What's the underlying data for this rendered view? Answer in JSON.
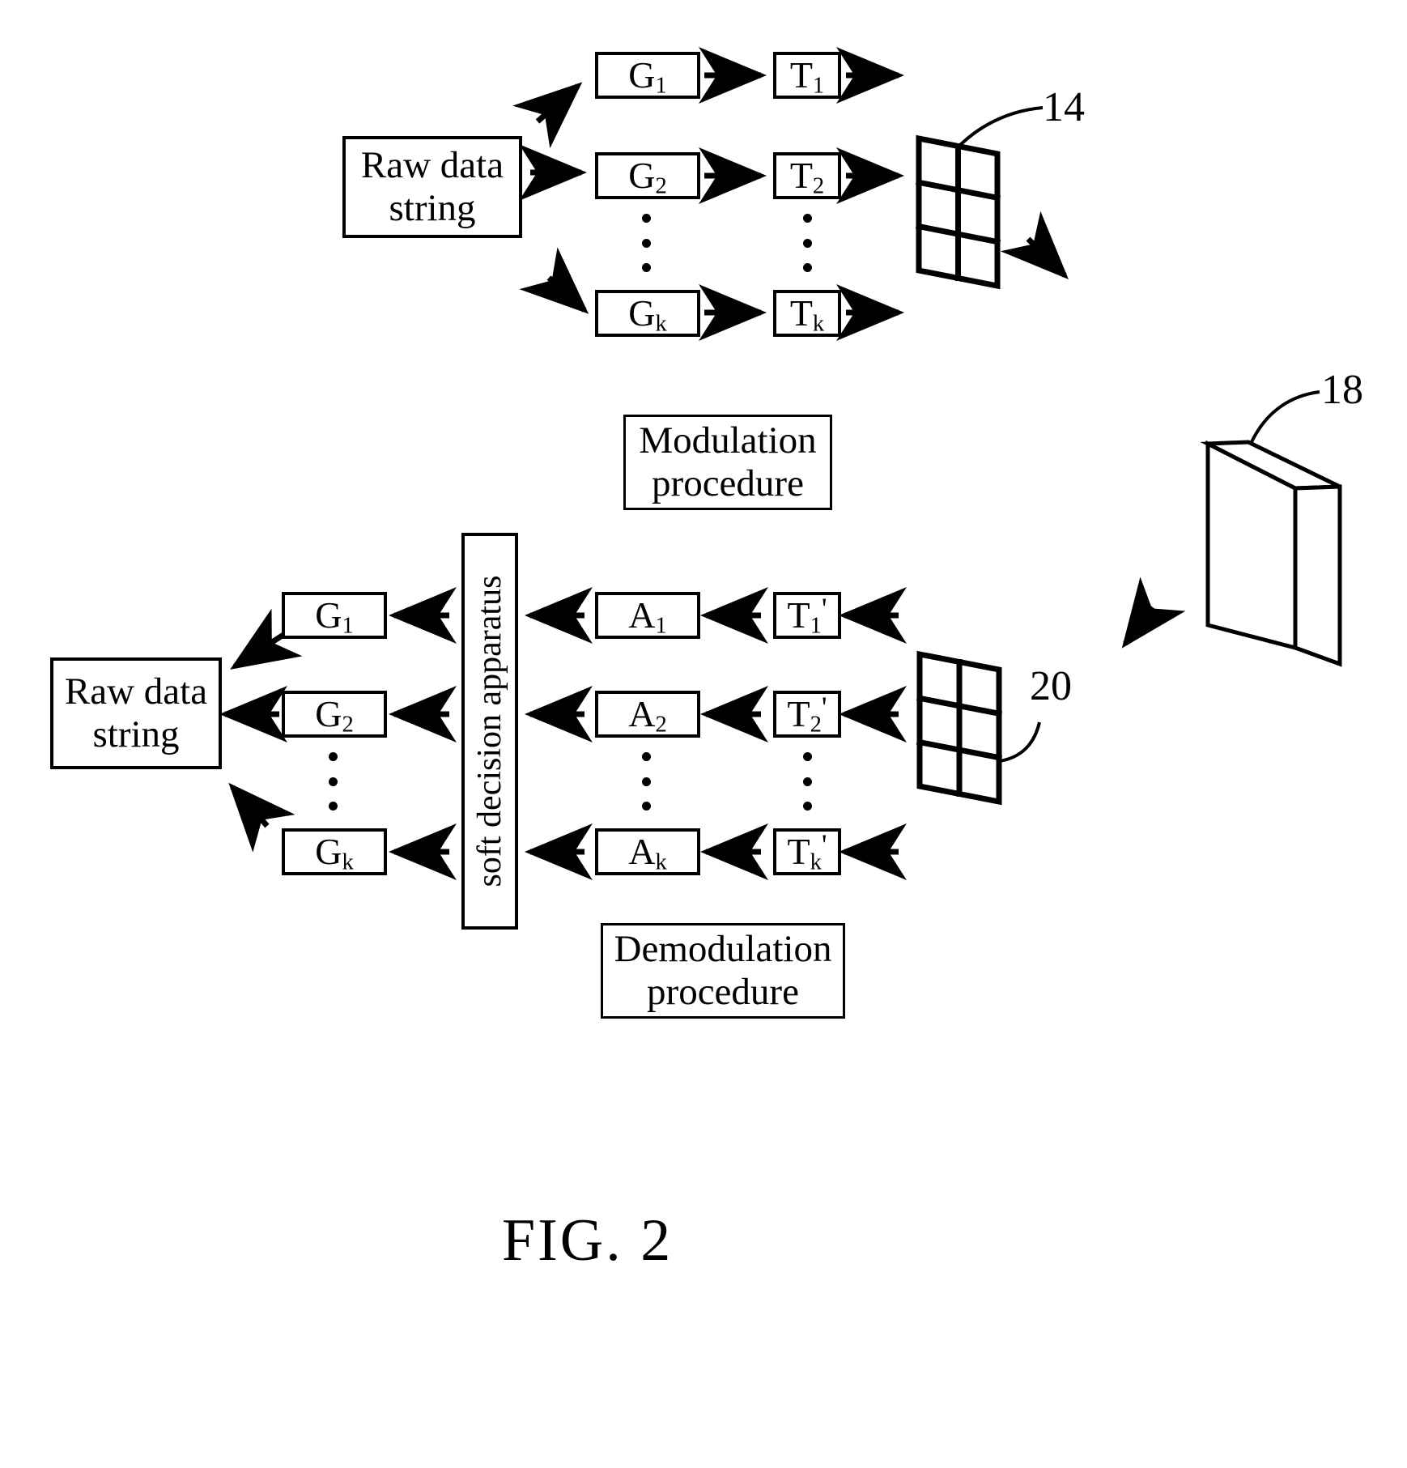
{
  "figure": {
    "caption": "FIG. 2",
    "reference_numerals": [
      {
        "id": "14",
        "label": "14"
      },
      {
        "id": "18",
        "label": "18"
      },
      {
        "id": "20",
        "label": "20"
      }
    ]
  },
  "transmit_path": {
    "source_block": {
      "line1": "Raw data",
      "line2": "string"
    },
    "encoder_blocks": [
      {
        "label": "G",
        "sub": "1"
      },
      {
        "label": "G",
        "sub": "2"
      },
      {
        "label": "G",
        "sub": "k"
      }
    ],
    "mapper_blocks": [
      {
        "label": "T",
        "sub": "1"
      },
      {
        "label": "T",
        "sub": "2"
      },
      {
        "label": "T",
        "sub": "k"
      }
    ],
    "procedure_label": {
      "line1": "Modulation",
      "line2": "procedure"
    },
    "grid_ref": "14",
    "medium_ref": "18"
  },
  "receive_path": {
    "grid_ref": "20",
    "demapper_blocks": [
      {
        "label": "T",
        "sub": "1",
        "prime": "'"
      },
      {
        "label": "T",
        "sub": "2",
        "prime": "'"
      },
      {
        "label": "T",
        "sub": "k",
        "prime": "'"
      }
    ],
    "metric_blocks": [
      {
        "label": "A",
        "sub": "1"
      },
      {
        "label": "A",
        "sub": "2"
      },
      {
        "label": "A",
        "sub": "k"
      }
    ],
    "decision_block": {
      "text": "soft decision apparatus"
    },
    "decoder_blocks": [
      {
        "label": "G",
        "sub": "1"
      },
      {
        "label": "G",
        "sub": "2"
      },
      {
        "label": "G",
        "sub": "k"
      }
    ],
    "sink_block": {
      "line1": "Raw data",
      "line2": "string"
    },
    "procedure_label": {
      "line1": "Demodulation",
      "line2": "procedure"
    }
  },
  "colors": {
    "ink": "#000000",
    "paper": "#ffffff"
  }
}
